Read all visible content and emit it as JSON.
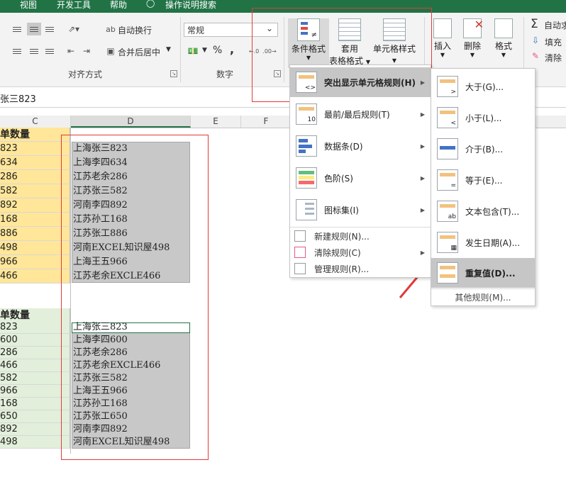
{
  "tabs": [
    "视图",
    "开发工具",
    "帮助",
    "操作说明搜索"
  ],
  "ribbon": {
    "wrap_text": "自动换行",
    "merge_center": "合并后居中",
    "alignment_group": "对齐方式",
    "number_format_value": "常规",
    "number_group": "数字",
    "percent_symbol": "%",
    "comma_symbol": ",",
    "conditional_format": "条件格式",
    "format_as_table_line1": "套用",
    "format_as_table_line2": "表格格式",
    "cell_styles": "单元格样式",
    "insert": "插入",
    "delete": "删除",
    "format": "格式",
    "autosum": "自动求",
    "fill": "填充",
    "clear": "清除"
  },
  "formula_bar": {
    "content": "张三823"
  },
  "columns": [
    "C",
    "D",
    "E",
    "F"
  ],
  "table1": {
    "header": "单数量",
    "c_values": [
      "823",
      "634",
      "286",
      "582",
      "892",
      "168",
      "886",
      "498",
      "966",
      "466"
    ],
    "d_values": [
      "上海张三823",
      "上海李四634",
      "江苏老余286",
      "江苏张三582",
      "河南李四892",
      "江苏孙工168",
      "江苏张工886",
      "河南EXCEL知识屋498",
      "上海王五966",
      "江苏老余EXCLE466"
    ]
  },
  "table2": {
    "header": "单数量",
    "c_values": [
      "823",
      "600",
      "286",
      "466",
      "582",
      "966",
      "168",
      "650",
      "892",
      "498"
    ],
    "d_values": [
      "上海张三823",
      "上海李四600",
      "江苏老余286",
      "江苏老余EXCLE466",
      "江苏张三582",
      "上海王五966",
      "江苏孙工168",
      "江苏张工650",
      "河南李四892",
      "河南EXCEL知识屋498"
    ]
  },
  "cf_menu": {
    "items": [
      {
        "label": "突出显示单元格规则(H)",
        "icon": "highlight-rules-icon"
      },
      {
        "label": "最前/最后规则(T)",
        "icon": "top-bottom-rules-icon"
      },
      {
        "label": "数据条(D)",
        "icon": "data-bars-icon"
      },
      {
        "label": "色阶(S)",
        "icon": "color-scales-icon"
      },
      {
        "label": "图标集(I)",
        "icon": "icon-sets-icon"
      }
    ],
    "small_items": [
      {
        "label": "新建规则(N)...",
        "icon": "new-rule-icon"
      },
      {
        "label": "清除规则(C)",
        "icon": "clear-rules-icon"
      },
      {
        "label": "管理规则(R)...",
        "icon": "manage-rules-icon"
      }
    ]
  },
  "sub_menu": {
    "items": [
      {
        "label": "大于(G)...",
        "icon": "greater-than-icon"
      },
      {
        "label": "小于(L)...",
        "icon": "less-than-icon"
      },
      {
        "label": "介于(B)...",
        "icon": "between-icon"
      },
      {
        "label": "等于(E)...",
        "icon": "equal-to-icon"
      },
      {
        "label": "文本包含(T)...",
        "icon": "text-contains-icon"
      },
      {
        "label": "发生日期(A)...",
        "icon": "date-occurring-icon"
      },
      {
        "label": "重复值(D)...",
        "icon": "duplicate-values-icon"
      }
    ],
    "more_rules": "其他规则(M)..."
  },
  "colors": {
    "excel_green": "#217346",
    "table1_fill": "#ffe699",
    "table2_fill": "#e2efda",
    "selection_gray": "#c8c8c8",
    "annotation_red": "#e23a3a"
  }
}
